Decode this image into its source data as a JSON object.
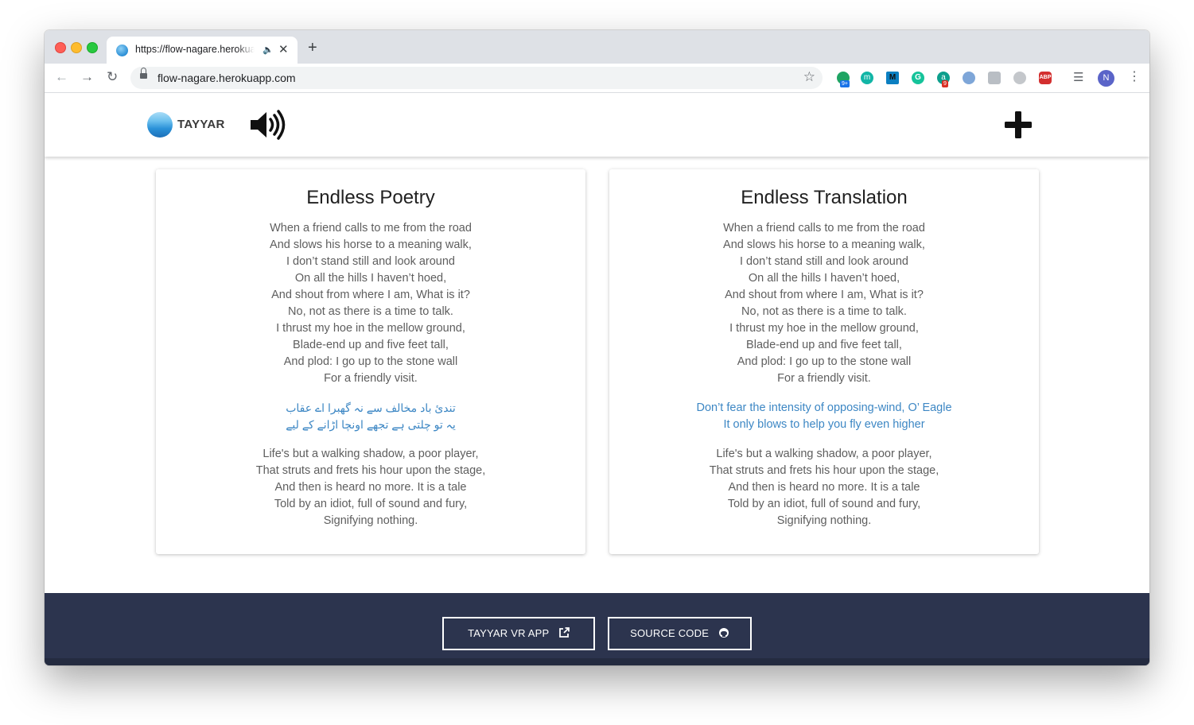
{
  "browser": {
    "tab_title": "https://flow-nagare.herokuapp.com",
    "url": "flow-nagare.herokuapp.com",
    "profile_initial": "N",
    "extension_badges": [
      "9+",
      "9"
    ]
  },
  "app": {
    "logo_text": "TAYYAR"
  },
  "cards": [
    {
      "title": "Endless Poetry",
      "stanza1": [
        "When a friend calls to me from the road",
        "And slows his horse to a meaning walk,",
        "I don’t stand still and look around",
        "On all the hills I haven’t hoed,",
        "And shout from where I am, What is it?",
        "No, not as there is a time to talk.",
        "I thrust my hoe in the mellow ground,",
        "Blade-end up and five feet tall,",
        "And plod: I go up to the stone wall",
        "For a friendly visit."
      ],
      "highlight": [
        "تندئ باد مخالف سے نہ گھبرا اے عقاب",
        "یہ تو چلتی ہے تجھے اونچا اڑانے کے لیے"
      ],
      "stanza2": [
        "Life's but a walking shadow, a poor player,",
        "That struts and frets his hour upon the stage,",
        "And then is heard no more. It is a tale",
        "Told by an idiot, full of sound and fury,",
        "Signifying nothing."
      ]
    },
    {
      "title": "Endless Translation",
      "stanza1": [
        "When a friend calls to me from the road",
        "And slows his horse to a meaning walk,",
        "I don’t stand still and look around",
        "On all the hills I haven’t hoed,",
        "And shout from where I am, What is it?",
        "No, not as there is a time to talk.",
        "I thrust my hoe in the mellow ground,",
        "Blade-end up and five feet tall,",
        "And plod: I go up to the stone wall",
        "For a friendly visit."
      ],
      "highlight": [
        "Don’t fear the intensity of opposing-wind, O’ Eagle",
        "It only blows to help you fly even higher"
      ],
      "stanza2": [
        "Life's but a walking shadow, a poor player,",
        "That struts and frets his hour upon the stage,",
        "And then is heard no more. It is a tale",
        "Told by an idiot, full of sound and fury,",
        "Signifying nothing."
      ]
    }
  ],
  "footer": {
    "vr_button": "TAYYAR VR APP",
    "source_button": "SOURCE CODE"
  },
  "colors": {
    "footer_bg": "#2c344e",
    "highlight_text": "#3d87c4",
    "body_text": "#5e5e5e"
  }
}
